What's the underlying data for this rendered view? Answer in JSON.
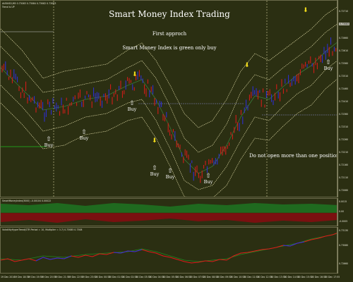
{
  "window": {
    "symbol_info": "AUDUSD,M5 0.73083 0.73084 0.73082 0.73083",
    "trend_info": "Trend is  UP"
  },
  "annotations": {
    "title": "Smart Money Index Trading",
    "subtitle_1": "First approch",
    "subtitle_2": "Smart Money Index is green only buy",
    "rule": "Do not open more than one position in the same direction"
  },
  "signals": {
    "buy_label": "Buy",
    "buy_arrow": "⇧",
    "sell_arrow": "⬇"
  },
  "indicators": {
    "smi_label": "SmartMoneyIndex(3000) -0.00104 0.00022",
    "vol_label": "VolatilityHyperTrend(STR Period = 10, Multiplier = 3.7) 0.73085 0.7308"
  },
  "price_axis": [
    {
      "label": "0.72710"
    },
    {
      "label": "0.72660"
    },
    {
      "label": "0.72610"
    },
    {
      "label": "0.72560"
    },
    {
      "label": "0.72510"
    },
    {
      "label": "0.72460"
    },
    {
      "label": "0.72410"
    },
    {
      "label": "0.72360"
    },
    {
      "label": "0.72310"
    },
    {
      "label": "0.72260"
    },
    {
      "label": "0.72210"
    },
    {
      "label": "0.72160"
    },
    {
      "label": "0.72110"
    },
    {
      "label": "0.72060"
    }
  ],
  "current_price": "0.73083",
  "smi_axis": [
    {
      "label": "0.0015"
    },
    {
      "label": "0.00"
    },
    {
      "label": "-0.0005"
    }
  ],
  "vol_axis": [
    {
      "label": "0.73130"
    },
    {
      "label": "0.73080"
    },
    {
      "label": "0.72660"
    }
  ],
  "time_axis": [
    "19 Dec 2016",
    "19 Dec 18:35",
    "19 Dec 19:55",
    "19 Dec 20:55",
    "19 Dec 21:55",
    "19 Dec 22:55",
    "19 Dec 23:55",
    "20 Dec 00:55",
    "20 Dec 01:55",
    "20 Dec 02:55",
    "20 Dec 03:55",
    "20 Dec 04:55",
    "20 Dec 05:55",
    "20 Dec 06:55",
    "20 Dec 07:55",
    "20 Dec 08:55",
    "20 Dec 09:55",
    "20 Dec 10:55",
    "20 Dec 11:55",
    "20 Dec 12:55",
    "20 Dec 13:55",
    "20 Dec 14:55",
    "20 Dec 15:55",
    "20 Dec 16:55",
    "20 Dec 17:55"
  ],
  "colors": {
    "background": "#2b2f12",
    "candle_up": "#2e2ee0",
    "candle_down": "#e01a1a",
    "band": "#d8d4a0",
    "smi_green": "#1f6a1f",
    "smi_red": "#7a1010",
    "sell_arrow": "#f2dc1a",
    "level_line": "#8a8acc"
  }
}
